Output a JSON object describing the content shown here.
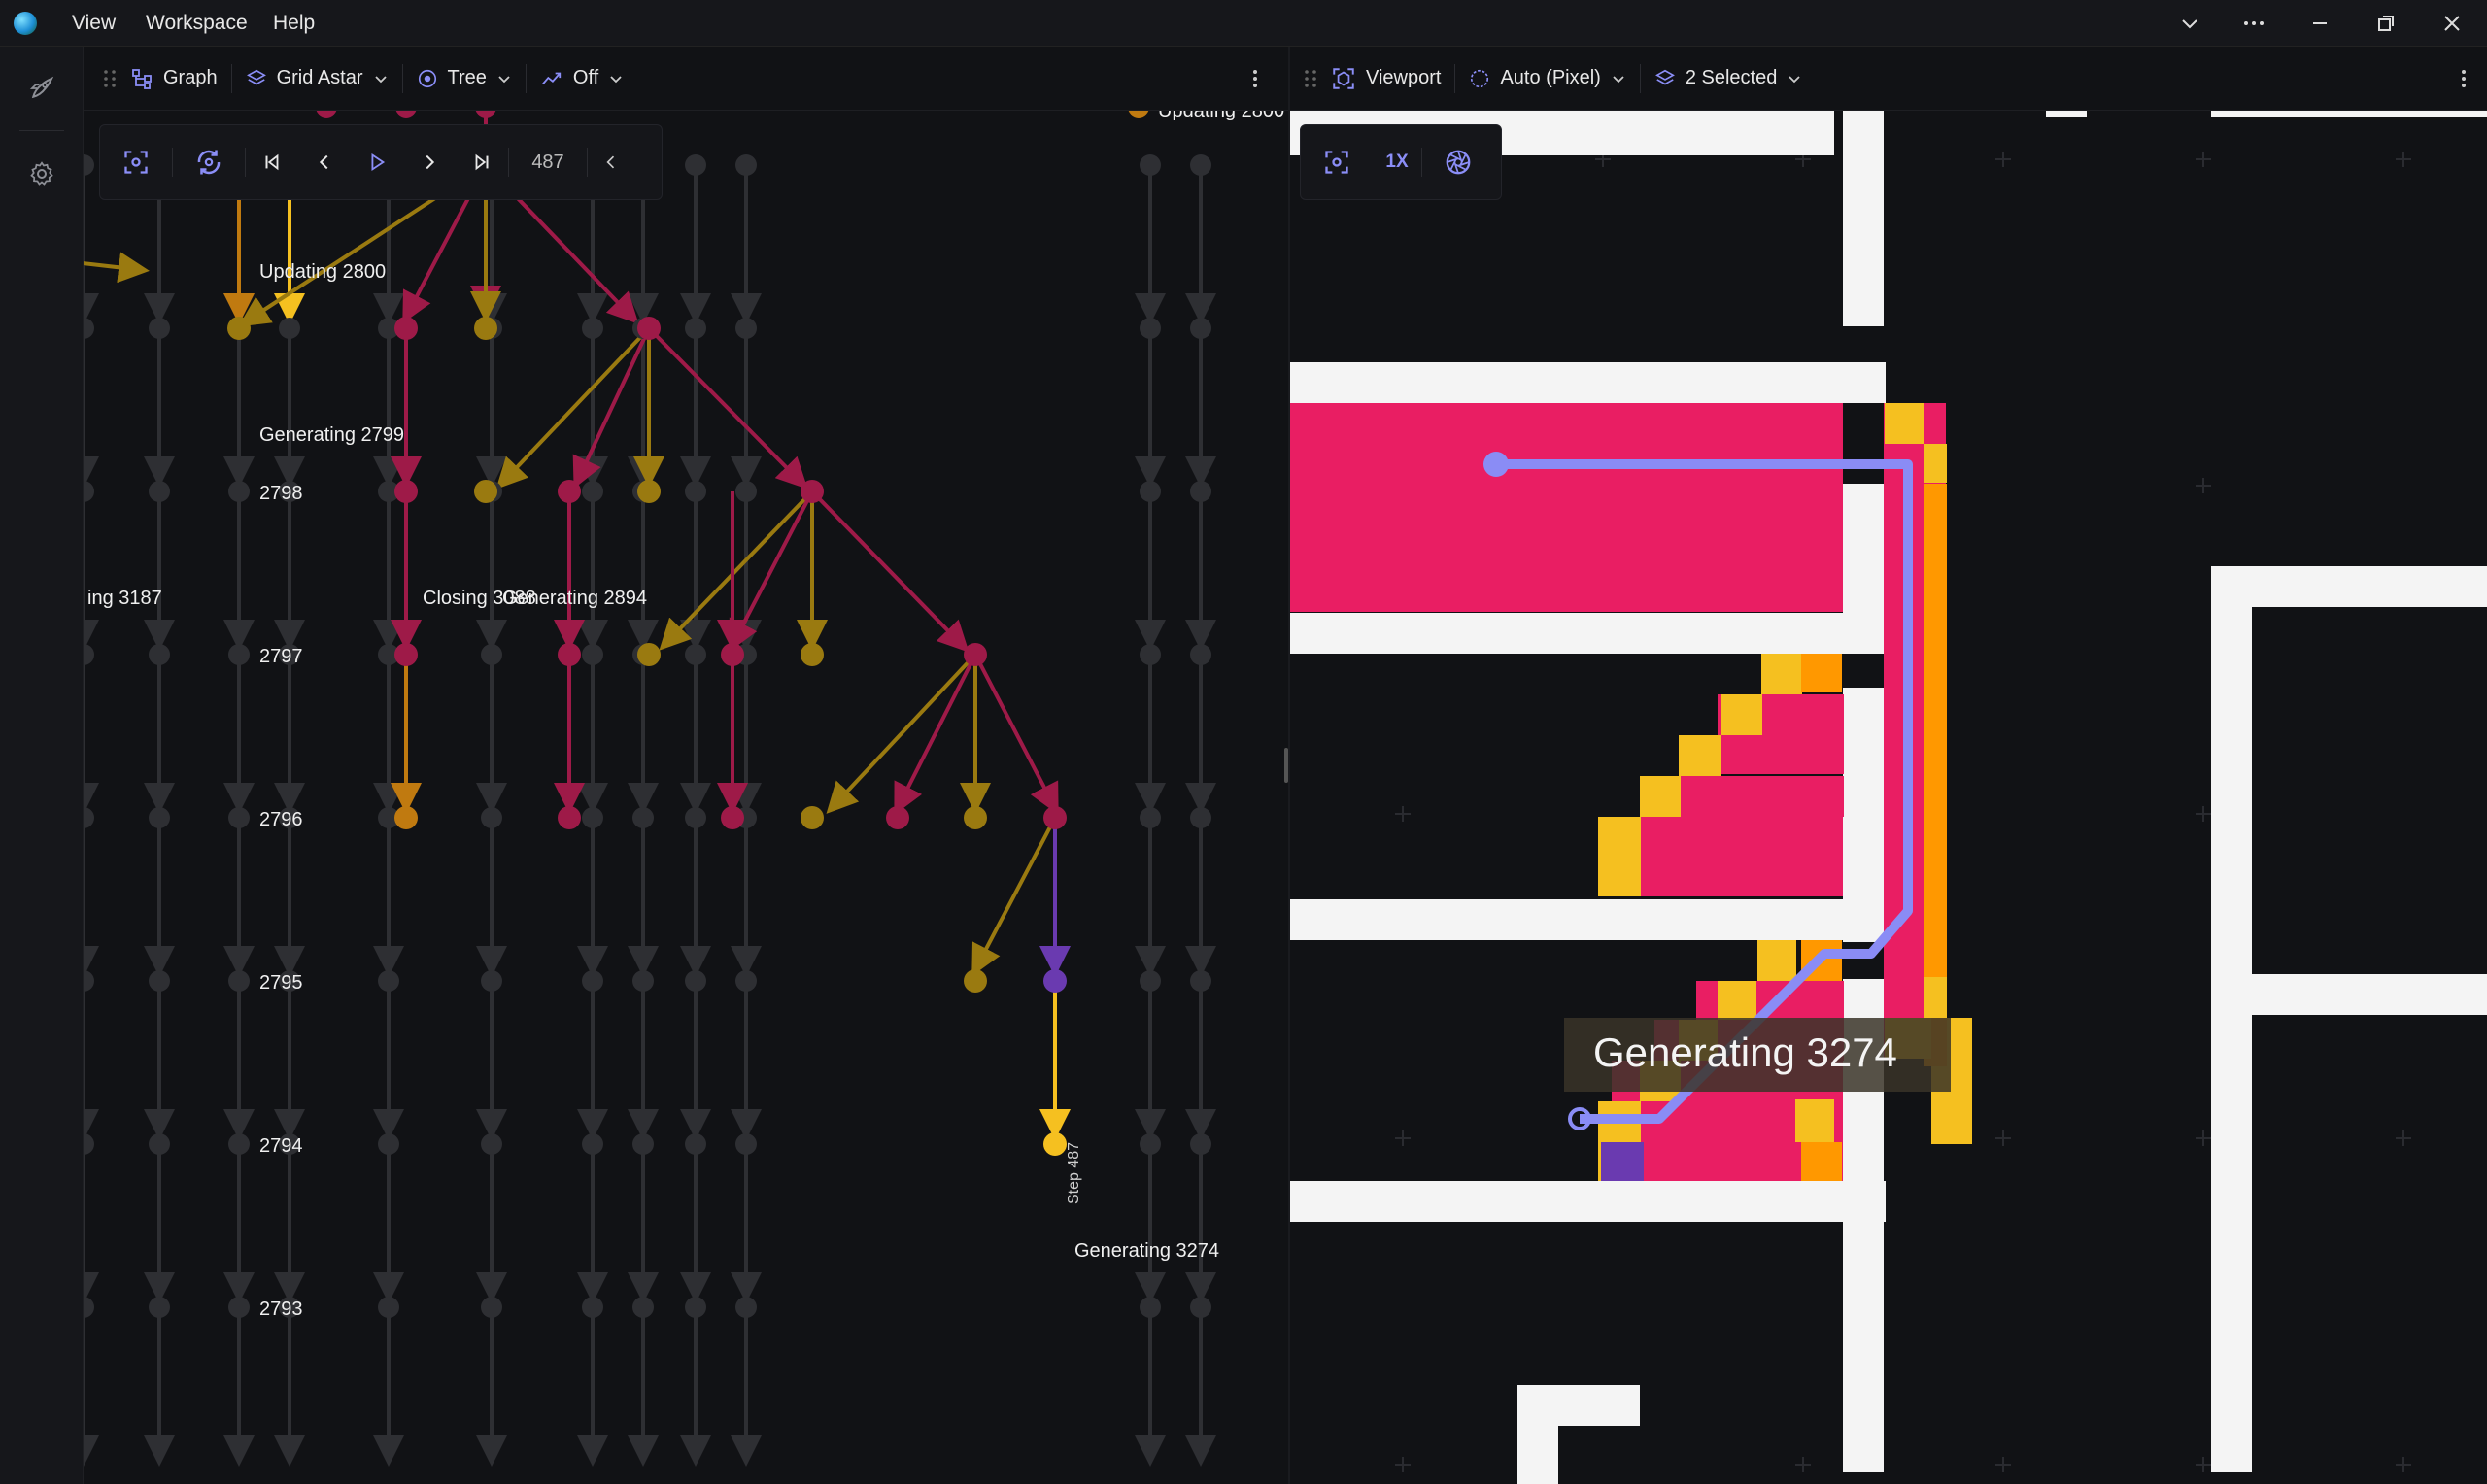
{
  "menu": {
    "view": "View",
    "workspace": "Workspace",
    "help": "Help"
  },
  "graph_toolbar": {
    "graph_label": "Graph",
    "algorithm_label": "Grid Astar",
    "layout_label": "Tree",
    "trace_label": "Off"
  },
  "playback": {
    "step": "487"
  },
  "viewport_toolbar": {
    "viewport_label": "Viewport",
    "render_mode_label": "Auto (Pixel)",
    "layers_label": "2 Selected"
  },
  "viewport_controls": {
    "zoom_label": "1X"
  },
  "graph": {
    "rows": [
      {
        "label": "2800"
      },
      {
        "label": "2799"
      },
      {
        "label": "2798"
      },
      {
        "label": "2797"
      },
      {
        "label": "2796"
      },
      {
        "label": "2795"
      },
      {
        "label": "2794"
      },
      {
        "label": "2793"
      }
    ],
    "node_labels": {
      "updating_top": "Updating 2800",
      "updating_clipped": "Updating 2800",
      "generating_2799": "Generating 2799",
      "clipped_3187": "ing 3187",
      "closing_3088": "Closing 3088",
      "generating_2894": "Generating 2894",
      "generating_3274": "Generating 3274",
      "step_label": "Step 487"
    }
  },
  "viewport": {
    "tooltip": "Generating 3274"
  },
  "colors": {
    "crimson": "#9e1a48",
    "gold": "#9a7a10",
    "amber": "#c07a10",
    "yellow": "#f5c020",
    "purple": "#6a3ab0",
    "grey_node": "#2e2f33",
    "path": "#8a8cf5",
    "pink": "#e91e63",
    "orange": "#ff9800",
    "wall": "#f4f4f4",
    "accent": "#8b8ef7"
  }
}
